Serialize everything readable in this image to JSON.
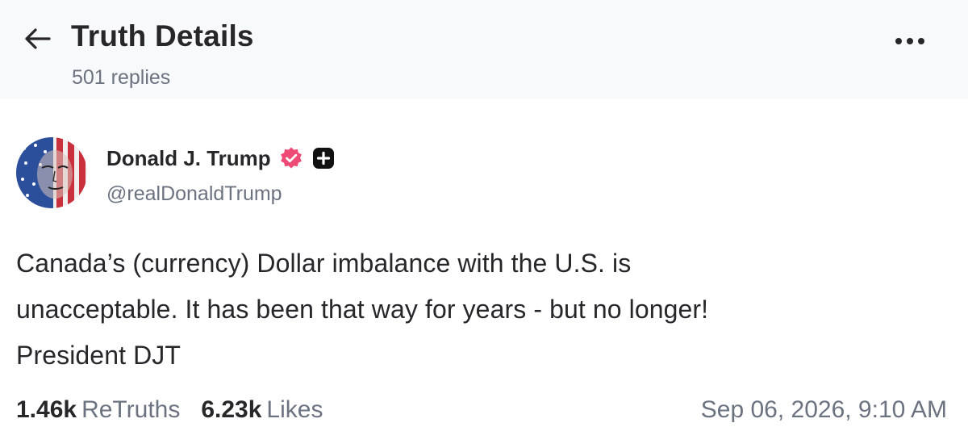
{
  "header": {
    "title": "Truth Details",
    "replies": "501 replies"
  },
  "author": {
    "name": "Donald J. Trump",
    "handle": "@realDonaldTrump"
  },
  "post": {
    "lines": [
      "Canada’s (currency) Dollar imbalance with the U.S. is",
      "unacceptable. It has been that way for years - but no longer!",
      "President DJT"
    ]
  },
  "stats": {
    "retruths_count": "1.46k",
    "retruths_label": "ReTruths",
    "likes_count": "6.23k",
    "likes_label": "Likes"
  },
  "timestamp": "Sep 06, 2026, 9:10 AM",
  "icons": {
    "back": "arrow-left-icon",
    "more": "more-horizontal-icon",
    "verified": "verified-badge-icon",
    "plus_badge": "plus-badge-icon"
  },
  "colors": {
    "verified_badge": "#ee4a75",
    "text_primary": "#27272a",
    "text_secondary": "#6b7280",
    "header_bg": "#f8f9fa"
  }
}
